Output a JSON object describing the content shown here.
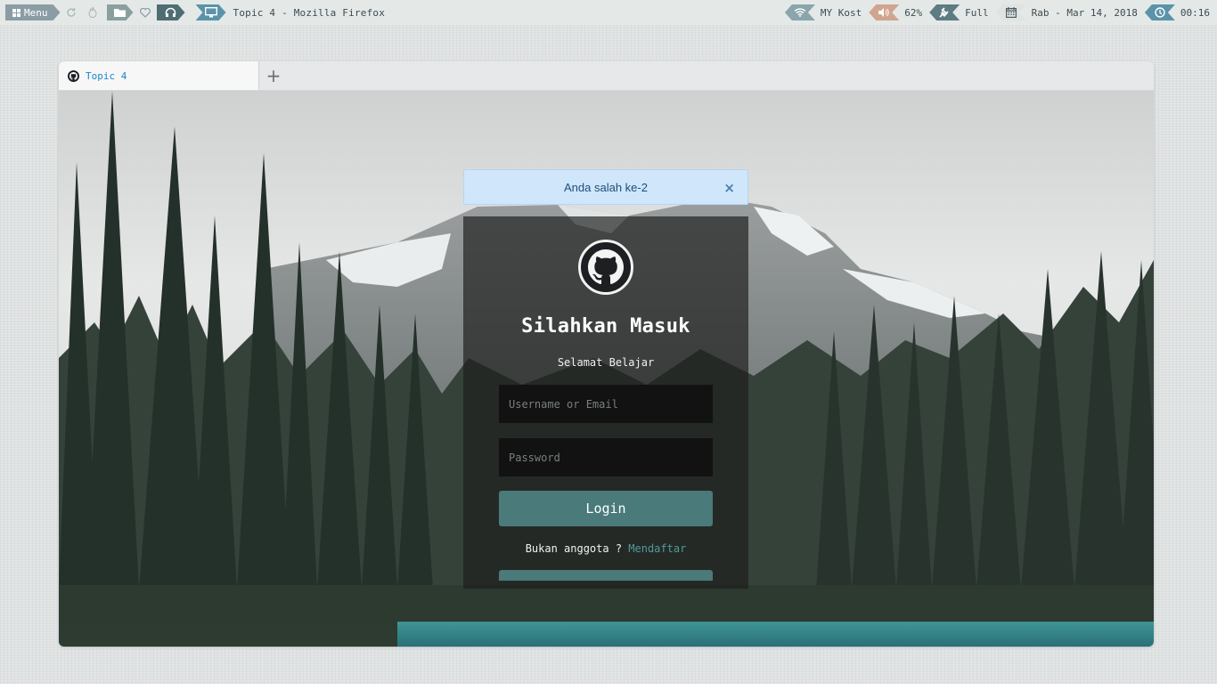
{
  "panel": {
    "menu_label": "Menu",
    "window_title": "Topic 4 - Mozilla Firefox",
    "network": "MY Kost",
    "volume": "62%",
    "power": "Full",
    "date": "Rab - Mar 14, 2018",
    "time": "00:16",
    "icons": [
      "grid-icon",
      "refresh-icon",
      "flame-icon",
      "folder-icon",
      "heart-icon",
      "headphones-icon",
      "monitor-icon",
      "wifi-icon",
      "speaker-icon",
      "plug-icon",
      "calendar-icon",
      "clock-icon"
    ]
  },
  "browser": {
    "tab_title": "Topic 4",
    "new_tab": "+"
  },
  "alert": {
    "message": "Anda salah ke-2",
    "close": "×"
  },
  "login": {
    "title": "Silahkan Masuk",
    "subtitle": "Selamat Belajar",
    "username_placeholder": "Username or Email",
    "password_placeholder": "Password",
    "login_button": "Login",
    "register_prompt": "Bukan anggota ? ",
    "register_link": "Mendaftar"
  },
  "colors": {
    "accent": "#4a7a79",
    "alert_bg": "#cfe6fb",
    "tab_text": "#1f84c9"
  }
}
